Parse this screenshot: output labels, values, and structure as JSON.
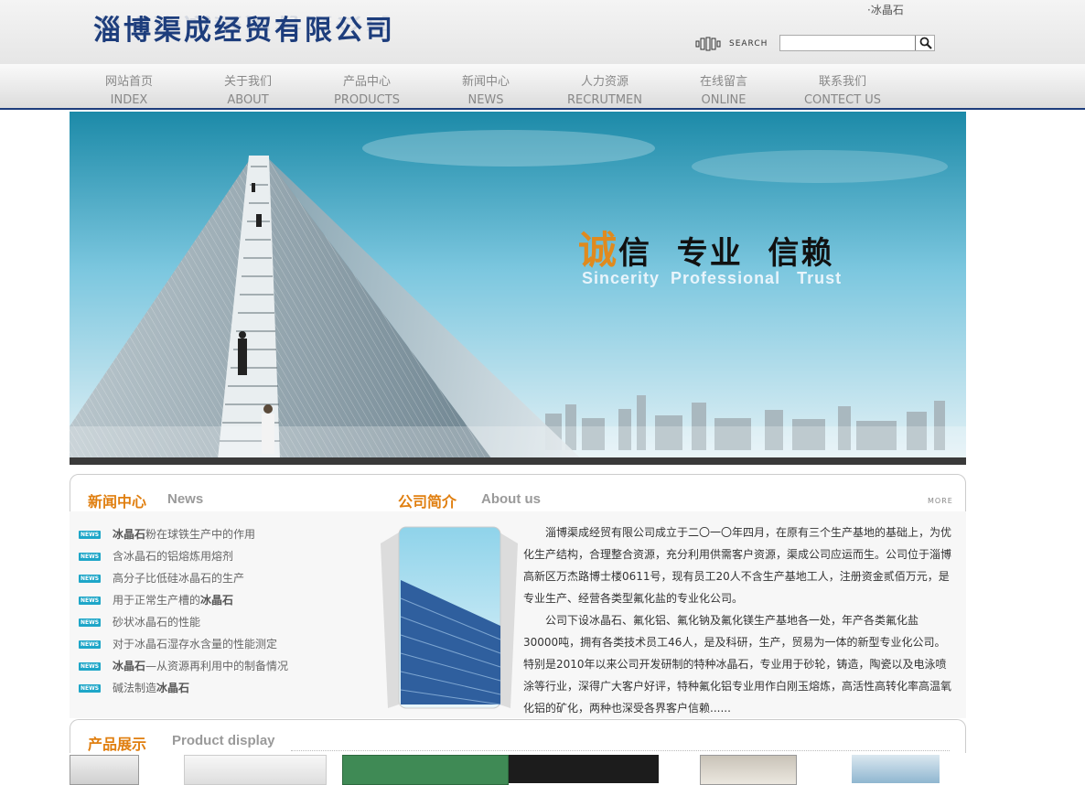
{
  "header": {
    "logo_text": "淄博渠成经贸有限公司",
    "top_link": "·冰晶石",
    "search_label": "SEARCH",
    "search_placeholder": ""
  },
  "nav": {
    "items": [
      {
        "cn": "网站首页",
        "en": "INDEX"
      },
      {
        "cn": "关于我们",
        "en": "ABOUT"
      },
      {
        "cn": "产品中心",
        "en": "PRODUCTS"
      },
      {
        "cn": "新闻中心",
        "en": "NEWS"
      },
      {
        "cn": "人力资源",
        "en": "RECRUTMEN"
      },
      {
        "cn": "在线留言",
        "en": "ONLINE"
      },
      {
        "cn": "联系我们",
        "en": "CONTECT US"
      }
    ]
  },
  "banner": {
    "slogan_first": "诚",
    "slogan_rest": "信  专业  信赖",
    "slogan_en": "Sincerity  Professional   Trust"
  },
  "news": {
    "title_cn": "新闻中心",
    "title_en": "News",
    "badge": "NEWS",
    "items": [
      {
        "bold_pre": "冰晶石",
        "text": "粉在球铁生产中的作用",
        "bold_post": ""
      },
      {
        "bold_pre": "",
        "text": "含冰晶石的铝熔炼用熔剂",
        "bold_post": ""
      },
      {
        "bold_pre": "",
        "text": "高分子比低硅冰晶石的生产",
        "bold_post": ""
      },
      {
        "bold_pre": "",
        "text": "用于正常生产槽的",
        "bold_post": "冰晶石"
      },
      {
        "bold_pre": "",
        "text": "砂状冰晶石的性能",
        "bold_post": ""
      },
      {
        "bold_pre": "",
        "text": "对于冰晶石湿存水含量的性能测定",
        "bold_post": ""
      },
      {
        "bold_pre": "冰晶石",
        "text": "—从资源再利用中的制备情况",
        "bold_post": ""
      },
      {
        "bold_pre": "",
        "text": "碱法制造",
        "bold_post": "冰晶石"
      }
    ]
  },
  "about": {
    "title_cn": "公司简介",
    "title_en": "About us",
    "more": "MORE",
    "paragraphs": [
      "淄博渠成经贸有限公司成立于二〇一〇年四月，在原有三个生产基地的基础上，为优化生产结构，合理整合资源，充分利用供需客户资源，渠成公司应运而生。公司位于淄博高新区万杰路博士楼0611号，现有员工20人不含生产基地工人，注册资金贰佰万元，是专业生产、经营各类型氟化盐的专业化公司。",
      "公司下设冰晶石、氟化铝、氟化钠及氟化镁生产基地各一处，年产各类氟化盐30000吨，拥有各类技术员工46人，是及科研，生产，贸易为一体的新型专业化公司。特别是2010年以来公司开发研制的特种冰晶石，专业用于砂轮，铸造，陶瓷以及电泳喷涂等行业，深得广大客户好评，特种氟化铝专业用作白刚玉熔炼，高活性高转化率高温氧化铝的矿化，两种也深受各界客户信赖......"
    ]
  },
  "products": {
    "title_cn": "产品展示",
    "title_en": "Product display"
  },
  "colors": {
    "brand_blue": "#1d3d7c",
    "accent_orange": "#e07f10",
    "news_badge": "#1ea6c8"
  }
}
